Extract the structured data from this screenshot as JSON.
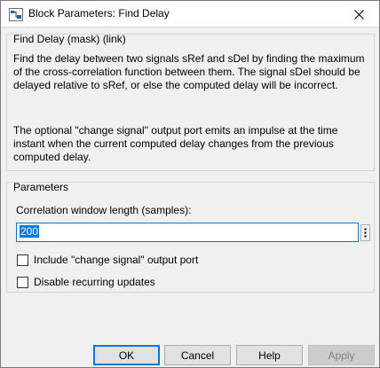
{
  "window": {
    "title": "Block Parameters: Find Delay",
    "close_icon": "close-icon",
    "app_icon": "simulink-block-icon"
  },
  "description": {
    "group_title": "Find Delay (mask) (link)",
    "paragraph1": "Find the delay between two signals sRef and sDel by finding the maximum of the cross-correlation function between them.  The signal sDel should be delayed relative to sRef, or else the computed delay will be incorrect.",
    "paragraph2": "The optional \"change signal\" output port emits an impulse at the time instant when the current computed delay changes from the previous computed delay."
  },
  "parameters": {
    "group_title": "Parameters",
    "correlation_label": "Correlation window length (samples):",
    "correlation_value": "200",
    "checkboxes": [
      {
        "label": "Include \"change signal\" output port",
        "checked": false
      },
      {
        "label": "Disable recurring updates",
        "checked": false
      }
    ]
  },
  "buttons": {
    "ok": "OK",
    "cancel": "Cancel",
    "help": "Help",
    "apply": "Apply"
  },
  "colors": {
    "accent": "#0078d7",
    "window_bg": "#f0f0f0"
  }
}
